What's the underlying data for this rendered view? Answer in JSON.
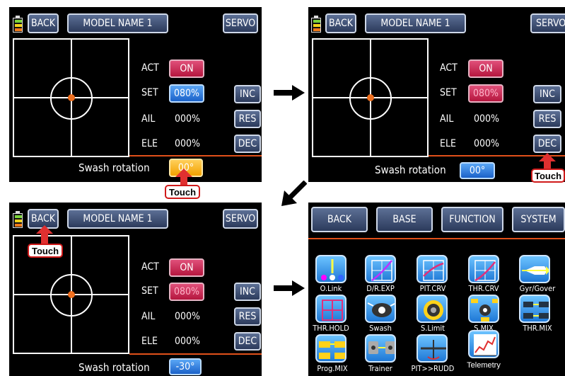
{
  "colors": {
    "red_button": "#c8204a",
    "blue_button": "#2a7ae0",
    "orange_button": "#f7b21a",
    "navy_button": "#3a4a6e",
    "center_dot": "#f07020"
  },
  "screens": [
    {
      "back": "BACK",
      "model": "MODEL NAME  1",
      "servo": "SERVO",
      "labels": {
        "act": "ACT",
        "set": "SET",
        "ail": "AIL",
        "ele": "ELE"
      },
      "values": {
        "act": "ON",
        "set": "080%",
        "ail": "000%",
        "ele": "000%"
      },
      "side": {
        "inc": "INC",
        "res": "RES",
        "dec": "DEC"
      },
      "swash_label": "Swash rotation",
      "swash_value": "00°",
      "touch": "Touch"
    },
    {
      "back": "BACK",
      "model": "MODEL NAME  1",
      "servo": "SERVO",
      "labels": {
        "act": "ACT",
        "set": "SET",
        "ail": "AIL",
        "ele": "ELE"
      },
      "values": {
        "act": "ON",
        "set": "080%",
        "ail": "000%",
        "ele": "000%"
      },
      "side": {
        "inc": "INC",
        "res": "RES",
        "dec": "DEC"
      },
      "swash_label": "Swash rotation",
      "swash_value": "00°",
      "touch": "Touch"
    },
    {
      "back": "BACK",
      "model": "MODEL NAME  1",
      "servo": "SERVO",
      "labels": {
        "act": "ACT",
        "set": "SET",
        "ail": "AIL",
        "ele": "ELE"
      },
      "values": {
        "act": "ON",
        "set": "080%",
        "ail": "000%",
        "ele": "000%"
      },
      "side": {
        "inc": "INC",
        "res": "RES",
        "dec": "DEC"
      },
      "swash_label": "Swash rotation",
      "swash_value": "-30°",
      "touch": "Touch"
    }
  ],
  "menu": {
    "tabs": [
      "BACK",
      "BASE",
      "FUNCTION",
      "SYSTEM"
    ],
    "icons": [
      {
        "label": "O.Link",
        "icon": "link-icon"
      },
      {
        "label": "D/R.EXP",
        "icon": "dr-exp-icon"
      },
      {
        "label": "PIT.CRV",
        "icon": "pitch-curve-icon"
      },
      {
        "label": "THR.CRV",
        "icon": "throttle-curve-icon"
      },
      {
        "label": "Gyr/Gover",
        "icon": "gyro-icon"
      },
      {
        "label": "THR.HOLD",
        "icon": "throttle-hold-icon"
      },
      {
        "label": "Swash",
        "icon": "swash-icon"
      },
      {
        "label": "S.Limit",
        "icon": "swash-limit-icon"
      },
      {
        "label": "S.MIX",
        "icon": "swash-mix-icon"
      },
      {
        "label": "THR.MIX",
        "icon": "throttle-mix-icon"
      },
      {
        "label": "Prog.MIX",
        "icon": "program-mix-icon"
      },
      {
        "label": "Trainer",
        "icon": "trainer-icon"
      },
      {
        "label": "PIT>>RUDD",
        "icon": "pitch-rudder-icon"
      },
      {
        "label": "Telemetry",
        "icon": "telemetry-icon"
      }
    ]
  }
}
